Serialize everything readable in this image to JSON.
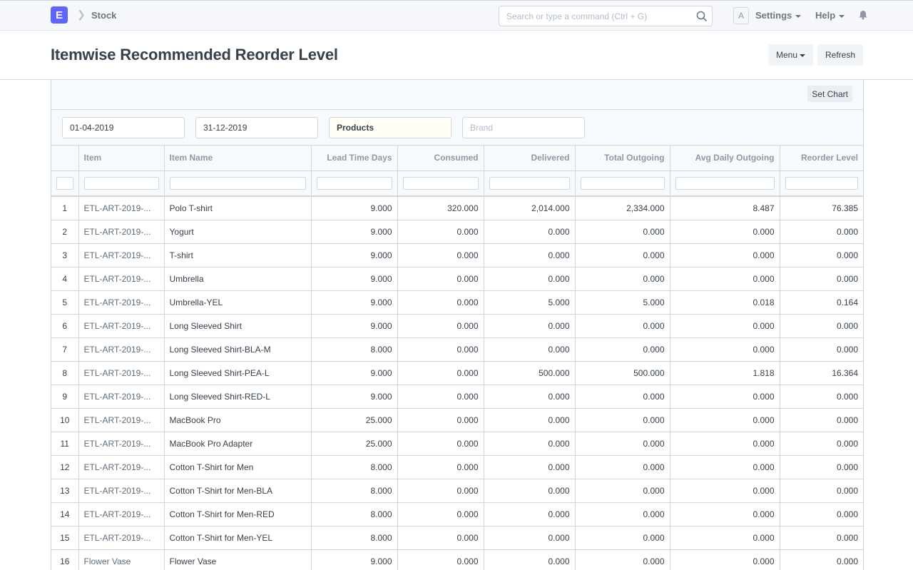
{
  "navbar": {
    "logo_letter": "E",
    "breadcrumb": "Stock",
    "search_placeholder": "Search or type a command (Ctrl + G)",
    "avatar_letter": "A",
    "settings_label": "Settings",
    "help_label": "Help"
  },
  "page": {
    "title": "Itemwise Recommended Reorder Level",
    "menu_label": "Menu",
    "refresh_label": "Refresh"
  },
  "report": {
    "set_chart_label": "Set Chart",
    "filters": {
      "from_date": "01-04-2019",
      "to_date": "31-12-2019",
      "item_group": "Products",
      "brand_placeholder": "Brand"
    },
    "columns": [
      "",
      "Item",
      "Item Name",
      "Lead Time Days",
      "Consumed",
      "Delivered",
      "Total Outgoing",
      "Avg Daily Outgoing",
      "Reorder Level"
    ],
    "rows": [
      [
        "1",
        "ETL-ART-2019-...",
        "Polo T-shirt",
        "9.000",
        "320.000",
        "2,014.000",
        "2,334.000",
        "8.487",
        "76.385"
      ],
      [
        "2",
        "ETL-ART-2019-...",
        "Yogurt",
        "9.000",
        "0.000",
        "0.000",
        "0.000",
        "0.000",
        "0.000"
      ],
      [
        "3",
        "ETL-ART-2019-...",
        "T-shirt",
        "9.000",
        "0.000",
        "0.000",
        "0.000",
        "0.000",
        "0.000"
      ],
      [
        "4",
        "ETL-ART-2019-...",
        "Umbrella",
        "9.000",
        "0.000",
        "0.000",
        "0.000",
        "0.000",
        "0.000"
      ],
      [
        "5",
        "ETL-ART-2019-...",
        "Umbrella-YEL",
        "9.000",
        "0.000",
        "5.000",
        "5.000",
        "0.018",
        "0.164"
      ],
      [
        "6",
        "ETL-ART-2019-...",
        "Long Sleeved Shirt",
        "9.000",
        "0.000",
        "0.000",
        "0.000",
        "0.000",
        "0.000"
      ],
      [
        "7",
        "ETL-ART-2019-...",
        "Long Sleeved Shirt-BLA-M",
        "8.000",
        "0.000",
        "0.000",
        "0.000",
        "0.000",
        "0.000"
      ],
      [
        "8",
        "ETL-ART-2019-...",
        "Long Sleeved Shirt-PEA-L",
        "9.000",
        "0.000",
        "500.000",
        "500.000",
        "1.818",
        "16.364"
      ],
      [
        "9",
        "ETL-ART-2019-...",
        "Long Sleeved Shirt-RED-L",
        "9.000",
        "0.000",
        "0.000",
        "0.000",
        "0.000",
        "0.000"
      ],
      [
        "10",
        "ETL-ART-2019-...",
        "MacBook Pro",
        "25.000",
        "0.000",
        "0.000",
        "0.000",
        "0.000",
        "0.000"
      ],
      [
        "11",
        "ETL-ART-2019-...",
        "MacBook Pro Adapter",
        "25.000",
        "0.000",
        "0.000",
        "0.000",
        "0.000",
        "0.000"
      ],
      [
        "12",
        "ETL-ART-2019-...",
        "Cotton T-Shirt for Men",
        "8.000",
        "0.000",
        "0.000",
        "0.000",
        "0.000",
        "0.000"
      ],
      [
        "13",
        "ETL-ART-2019-...",
        "Cotton T-Shirt for Men-BLA",
        "8.000",
        "0.000",
        "0.000",
        "0.000",
        "0.000",
        "0.000"
      ],
      [
        "14",
        "ETL-ART-2019-...",
        "Cotton T-Shirt for Men-RED",
        "8.000",
        "0.000",
        "0.000",
        "0.000",
        "0.000",
        "0.000"
      ],
      [
        "15",
        "ETL-ART-2019-...",
        "Cotton T-Shirt for Men-YEL",
        "8.000",
        "0.000",
        "0.000",
        "0.000",
        "0.000",
        "0.000"
      ],
      [
        "16",
        "Flower Vase",
        "Flower Vase",
        "9.000",
        "0.000",
        "0.000",
        "0.000",
        "0.000",
        "0.000"
      ]
    ]
  }
}
